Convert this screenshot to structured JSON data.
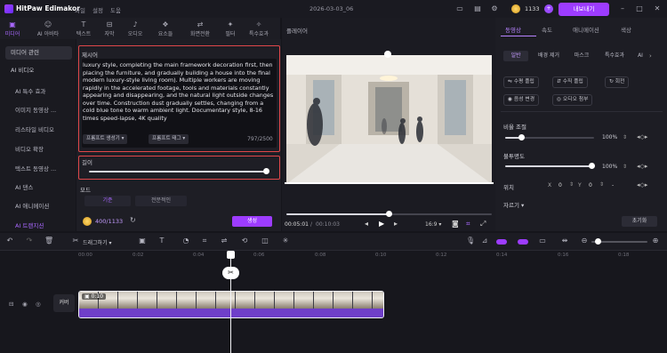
{
  "app": {
    "name": "HitPaw Edimakor",
    "menu": [
      "파일",
      "설정",
      "도움"
    ],
    "document": "2026-03-03_06",
    "credits": "1133",
    "buy_label": "내보내기"
  },
  "toolbar": [
    {
      "icon": "media-icon",
      "label": "미디어"
    },
    {
      "icon": "ai-icon",
      "label": "AI 아바타"
    },
    {
      "icon": "text-icon",
      "label": "텍스트"
    },
    {
      "icon": "subtitle-icon",
      "label": "자막"
    },
    {
      "icon": "audio-icon",
      "label": "오디오"
    },
    {
      "icon": "element-icon",
      "label": "요소들"
    },
    {
      "icon": "transition-icon",
      "label": "화면전환"
    },
    {
      "icon": "filter-icon",
      "label": "필터"
    },
    {
      "icon": "effects-icon",
      "label": "특수효과"
    }
  ],
  "sidebar": {
    "categories": [
      "미디어 관련",
      "AI 비디오"
    ],
    "items": [
      "AI 특수 효과",
      "이미지 동영상 ...",
      "리스타일 비디오",
      "비디오 확장",
      "텍스트 동영상 ...",
      "AI 댄스",
      "AI 애니메이션",
      "AI 트랜지션"
    ]
  },
  "generator": {
    "prompt_label": "제시어",
    "prompt_text": "luxury style, completing the main framework decoration first, then placing the furniture, and gradually building a house into the final modern luxury-style living room). Multiple workers are moving rapidly in the accelerated footage, tools and materials constantly appearing and disappearing, and the natural light outside changes over time. Construction dust gradually settles, changing from a cold blue tone to warm ambient light. Documentary style, 8-16 times speed-lapse, 4K quality",
    "btn_generate_prompt": "프롬프트 생성기",
    "btn_prompt_tag": "프롬프트 태그",
    "char_count": "797/2500",
    "length_label": "길이",
    "length_value": 1.0,
    "mode_label": "모드",
    "mode_options": [
      "기준",
      "전문적인"
    ],
    "cost": "400/1133",
    "generate_label": "생성"
  },
  "preview": {
    "title": "플레이어",
    "current_time": "00:05:01",
    "total_time": "00:10:03",
    "ratio": "16:9",
    "progress": 0.5
  },
  "right": {
    "tabs": [
      "동영상",
      "속도",
      "애니메이션",
      "색상"
    ],
    "subtabs": [
      "일반",
      "배경 제거",
      "마스크",
      "특수효과",
      "AI"
    ],
    "buttons": [
      "수평 플립",
      "수직 플립",
      "회전",
      "음성 변경",
      "오디오 첨부"
    ],
    "scale_label": "비율 조절",
    "scale_value": "100%",
    "opacity_label": "불투명도",
    "opacity_value": "100%",
    "position_label": "위치",
    "pos_x_label": "X",
    "pos_x": "0",
    "pos_y_label": "Y",
    "pos_y": "0",
    "pos_suffix": "-",
    "adjust_label": "자르기",
    "reset_label": "초기화"
  },
  "timeline": {
    "ruler": [
      "00:00",
      "0:02",
      "0:04",
      "0:06",
      "0:08",
      "0:10",
      "0:12",
      "0:14",
      "0:16",
      "0:18"
    ],
    "split_label": "드래그하기",
    "cover_label": "커버",
    "clip_duration": "0:10"
  }
}
